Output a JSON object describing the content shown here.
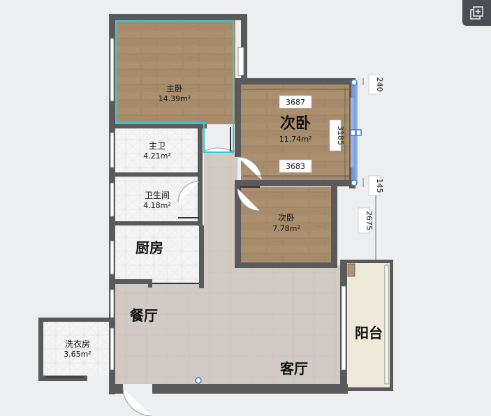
{
  "rooms": {
    "master_bedroom": {
      "name": "主卧",
      "area": "14.39m²"
    },
    "second_bedroom": {
      "name": "次卧",
      "area": "11.74m²"
    },
    "third_bedroom": {
      "name": "次卧",
      "area": "7.78m²"
    },
    "master_bath": {
      "name": "主卫",
      "area": "4.21m²"
    },
    "bathroom": {
      "name": "卫生间",
      "area": "4.18m²"
    },
    "kitchen": {
      "name": "厨房"
    },
    "dining": {
      "name": "餐厅"
    },
    "living": {
      "name": "客厅"
    },
    "balcony": {
      "name": "阳台"
    },
    "laundry": {
      "name": "洗衣房",
      "area": "3.65m²"
    }
  },
  "dimensions": {
    "top_width": "3687",
    "bottom_width": "3683",
    "height": "3185",
    "gap_top": "240",
    "gap_bottom": "145",
    "side_length": "2675"
  },
  "colors": {
    "wood": "#a78b6a",
    "wall": "#5a5a5a",
    "tile": "#f3f3f3",
    "floor": "#cfc8c0",
    "balcony": "#efe9d9",
    "selection": "#38c9d6",
    "handle": "#3f7ee0"
  },
  "toolbar": {
    "icon": "add-layer-icon"
  }
}
